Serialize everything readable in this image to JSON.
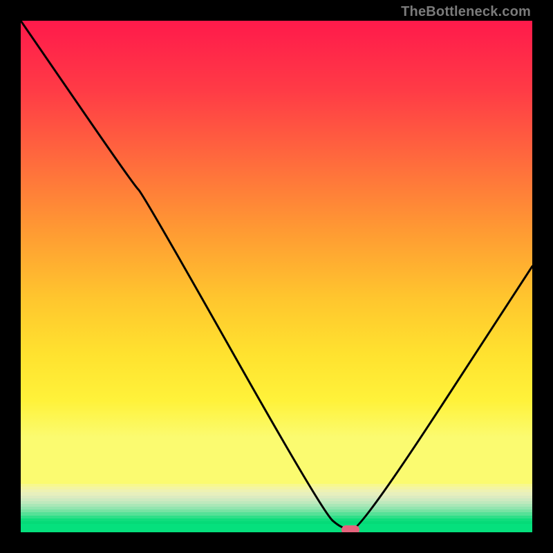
{
  "watermark": "TheBottleneck.com",
  "chart_data": {
    "type": "line",
    "title": "",
    "xlabel": "",
    "ylabel": "",
    "xlim": [
      0,
      100
    ],
    "ylim": [
      0,
      100
    ],
    "x": [
      0,
      22,
      24,
      59,
      63,
      66.5,
      100
    ],
    "values": [
      100,
      68,
      66,
      4,
      0.5,
      0.5,
      52
    ],
    "marker": {
      "x": 64.5,
      "y": 0.5
    },
    "background_gradient": {
      "stops": [
        {
          "pos": 0.0,
          "color": "#ff1a4b"
        },
        {
          "pos": 0.15,
          "color": "#ff3b46"
        },
        {
          "pos": 0.3,
          "color": "#ff6a3d"
        },
        {
          "pos": 0.45,
          "color": "#ff9933"
        },
        {
          "pos": 0.6,
          "color": "#ffc62e"
        },
        {
          "pos": 0.72,
          "color": "#ffe22f"
        },
        {
          "pos": 0.82,
          "color": "#fff23a"
        },
        {
          "pos": 0.9,
          "color": "#fbfb70"
        }
      ],
      "bottom_strips": [
        "#f7f88f",
        "#f3f5a2",
        "#eef2b2",
        "#e7efbd",
        "#dcebc0",
        "#ceeac0",
        "#bee9bd",
        "#aae7b7",
        "#93e5af",
        "#77e3a4",
        "#55e197",
        "#2fdf89",
        "#0fdd7d",
        "#05da78"
      ],
      "green_bar": "#05e07d"
    },
    "curve_color": "#000000",
    "marker_color": "#e6647d"
  }
}
